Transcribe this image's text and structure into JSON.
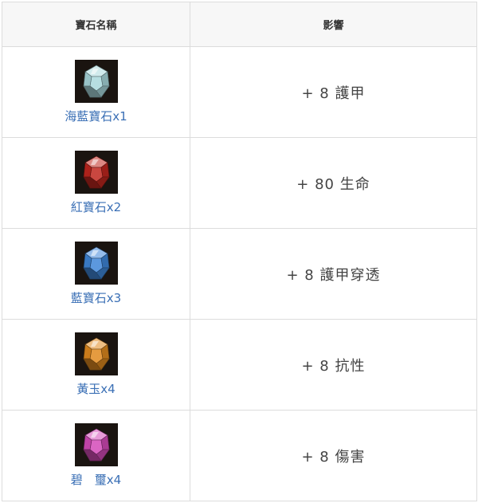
{
  "table": {
    "headers": {
      "name": "寶石名稱",
      "effect": "影響"
    },
    "rows": [
      {
        "name": "海藍寶石x1",
        "effect": "+ 8 護甲",
        "icon": "aquamarine-gem-icon",
        "color": "#a9d8dc"
      },
      {
        "name": "紅寶石x2",
        "effect": "+ 80 生命",
        "icon": "ruby-gem-icon",
        "color": "#c0261e"
      },
      {
        "name": "藍寶石x3",
        "effect": "+ 8 護甲穿透",
        "icon": "sapphire-gem-icon",
        "color": "#3f86d8"
      },
      {
        "name": "黃玉x4",
        "effect": "+ 8 抗性",
        "icon": "topaz-gem-icon",
        "color": "#e0891e"
      },
      {
        "name": "碧　璽x4",
        "effect": "+ 8 傷害",
        "icon": "tourmaline-gem-icon",
        "color": "#d44ab8"
      }
    ]
  },
  "colors": {
    "link_text": "#3a6fb5",
    "header_bg": "#f7f7f7",
    "border": "#dcdcdc"
  }
}
